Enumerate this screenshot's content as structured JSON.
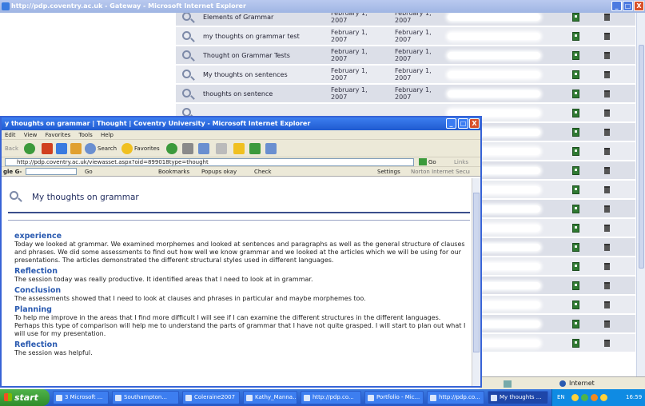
{
  "bg_window": {
    "title": "http://pdp.coventry.ac.uk - Gateway - Microsoft Internet Explorer",
    "controls": [
      "_",
      "□",
      "X"
    ]
  },
  "bg_rows": [
    {
      "title": "Elements of Grammar",
      "date1": "February 1, 2007",
      "date2": "February 1, 2007"
    },
    {
      "title": "my thoughts on grammar test",
      "date1": "February 1, 2007",
      "date2": "February 1, 2007"
    },
    {
      "title": "Thought on Grammar Tests",
      "date1": "February 1, 2007",
      "date2": "February 1, 2007"
    },
    {
      "title": "My thoughts on sentences",
      "date1": "February 1, 2007",
      "date2": "February 1, 2007"
    },
    {
      "title": "thoughts on sentence",
      "date1": "February 1, 2007",
      "date2": "February 1, 2007"
    },
    {
      "title": "",
      "date1": "",
      "date2": ""
    },
    {
      "title": "",
      "date1": "",
      "date2": ""
    },
    {
      "title": "",
      "date1": "",
      "date2": ""
    },
    {
      "title": "",
      "date1": "",
      "date2": ""
    },
    {
      "title": "",
      "date1": "",
      "date2": ""
    },
    {
      "title": "",
      "date1": "",
      "date2": ""
    },
    {
      "title": "",
      "date1": "",
      "date2": ""
    },
    {
      "title": "",
      "date1": "",
      "date2": ""
    },
    {
      "title": "",
      "date1": "",
      "date2": ""
    },
    {
      "title": "",
      "date1": "",
      "date2": ""
    },
    {
      "title": "",
      "date1": "",
      "date2": ""
    },
    {
      "title": "",
      "date1": "",
      "date2": ""
    },
    {
      "title": "",
      "date1": "",
      "date2": ""
    }
  ],
  "bg_status": {
    "zone": "Internet"
  },
  "fg_window": {
    "title": "y thoughts on grammar | Thought | Coventry University - Microsoft Internet Explorer",
    "menu": [
      "Edit",
      "View",
      "Favorites",
      "Tools",
      "Help"
    ],
    "toolbar": {
      "back": "Back",
      "search": "Search",
      "favorites": "Favorites"
    },
    "address": "http://pdp.coventry.ac.uk/viewasset.aspx?oid=899018type=thought",
    "go": "Go",
    "links": "Links",
    "google_bar": {
      "logo": "gle G-",
      "go": "Go",
      "bookmarks": "Bookmarks",
      "popups": "Popups okay",
      "check": "Check",
      "settings": "Settings",
      "norton": "Norton Internet Security"
    },
    "page": {
      "title": "My thoughts on grammar",
      "sections": [
        {
          "heading": "experience",
          "text": "Today we looked at grammar. We examined morphemes and looked at sentences and paragraphs as well as the general structure of clauses and phrases. We did some assessments to find out how well we know grammar and we looked at the articles which we will be using for our presentations. The articles demonstrated the different structural styles used in different languages."
        },
        {
          "heading": "Reflection",
          "text": "The session today was really productive. It identified areas that I need to look at in grammar."
        },
        {
          "heading": "Conclusion",
          "text": "The assessments showed that I need to look at clauses and phrases in particular and maybe morphemes too."
        },
        {
          "heading": "Planning",
          "text": "To help me improve in the areas that I find more difficult I will see if I can examine the different structures in the different languages. Perhaps this type of comparison will help me to understand the parts of grammar that I have not quite grasped. I will start to plan out what I will use for my presentation."
        },
        {
          "heading": "Reflection",
          "text": "The session was helpful."
        }
      ]
    }
  },
  "taskbar": {
    "start": "start",
    "buttons": [
      "3 Microsoft ...",
      "Southampton...",
      "Coleraine2007",
      "Kathy_Manna...",
      "http://pdp.co...",
      "Portfolio - Mic...",
      "http://pdp.co...",
      "My thoughts ..."
    ],
    "tray": {
      "lang": "EN",
      "time": "16:59"
    }
  }
}
